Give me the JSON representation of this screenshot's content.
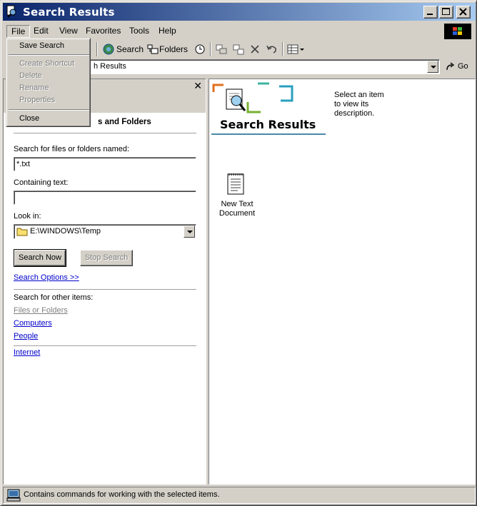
{
  "window": {
    "title": "Search Results"
  },
  "menubar": {
    "items": [
      "File",
      "Edit",
      "View",
      "Favorites",
      "Tools",
      "Help"
    ],
    "active": "File"
  },
  "file_menu": {
    "items": [
      {
        "label": "Save Search",
        "enabled": true
      },
      {
        "label": "Create Shortcut",
        "enabled": false
      },
      {
        "label": "Delete",
        "enabled": false
      },
      {
        "label": "Rename",
        "enabled": false
      },
      {
        "label": "Properties",
        "enabled": false
      },
      {
        "label": "Close",
        "enabled": true
      }
    ]
  },
  "toolbar": {
    "search_label": "Search",
    "folders_label": "Folders"
  },
  "address": {
    "value": "h Results",
    "go_label": "Go"
  },
  "search_pane": {
    "header_partial": "s and Folders",
    "named_label": "Search for files or folders named:",
    "named_value": "*.txt",
    "containing_label": "Containing text:",
    "containing_value": "",
    "lookin_label": "Look in:",
    "lookin_value": "E:\\WINDOWS\\Temp",
    "search_now_label": "Search Now",
    "stop_search_label": "Stop Search",
    "search_options_label": "Search Options >>",
    "other_items_label": "Search for other items:",
    "other_links": [
      "Files or Folders",
      "Computers",
      "People"
    ],
    "internet_label": "Internet"
  },
  "results_pane": {
    "title": "Search Results",
    "description": "Select an item to view its description.",
    "files": [
      {
        "name": "New Text Document"
      }
    ]
  },
  "statusbar": {
    "text": "Contains commands for working with the selected items."
  },
  "colors": {
    "titlebar_start": "#0a246a",
    "titlebar_end": "#a6caf0",
    "face": "#d4d0c8",
    "link": "#0000cc"
  }
}
